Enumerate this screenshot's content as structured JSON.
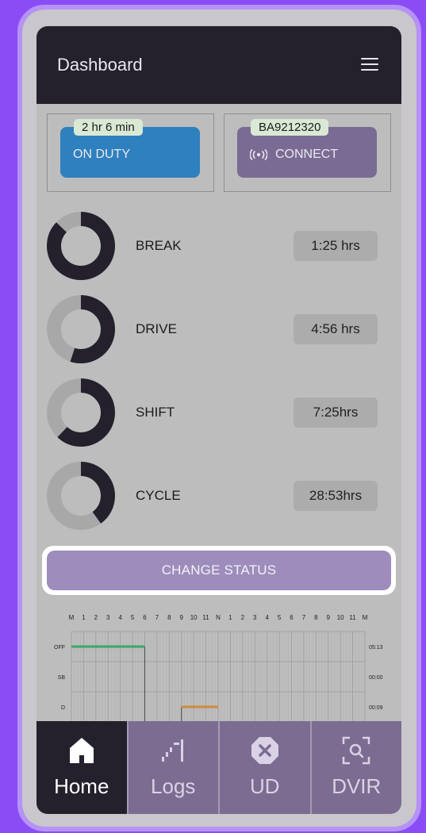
{
  "header": {
    "title": "Dashboard",
    "menu_icon": "hamburger-menu-icon"
  },
  "status": {
    "duty": {
      "timer": "2 hr 6 min",
      "label": "ON DUTY",
      "color": "#2f80be"
    },
    "device": {
      "id": "BA9212320",
      "label": "CONNECT",
      "icon": "wireless-signal-icon",
      "color": "#7a6b94"
    }
  },
  "timers": [
    {
      "label": "BREAK",
      "value": "1:25 hrs",
      "progress": 0.87
    },
    {
      "label": "DRIVE",
      "value": "4:56 hrs",
      "progress": 0.55
    },
    {
      "label": "SHIFT",
      "value": "7:25hrs",
      "progress": 0.62
    },
    {
      "label": "CYCLE",
      "value": "28:53hrs",
      "progress": 0.4
    }
  ],
  "change_status": {
    "label": "CHANGE STATUS"
  },
  "chart_data": {
    "type": "line",
    "x_ticks": [
      "M",
      "1",
      "2",
      "3",
      "4",
      "5",
      "6",
      "7",
      "8",
      "9",
      "10",
      "11",
      "N",
      "1",
      "2",
      "3",
      "4",
      "5",
      "6",
      "7",
      "8",
      "9",
      "10",
      "11",
      "M"
    ],
    "rows": [
      "OFF",
      "SB",
      "D"
    ],
    "totals": [
      "05:13",
      "00:00",
      "00:09"
    ],
    "segments": [
      {
        "row": "OFF",
        "start_hour": 0,
        "end_hour": 6,
        "color": "#3aa866"
      },
      {
        "row": "D",
        "start_hour": 9,
        "end_hour": 12,
        "color": "#d08a3a"
      }
    ],
    "transitions": [
      {
        "hour": 6,
        "from": "OFF",
        "to": "below"
      },
      {
        "hour": 9,
        "from": "below",
        "to": "D"
      }
    ]
  },
  "nav": [
    {
      "label": "Home",
      "icon": "home-icon",
      "active": true
    },
    {
      "label": "Logs",
      "icon": "logs-icon",
      "active": false
    },
    {
      "label": "UD",
      "icon": "close-circle-icon",
      "active": false
    },
    {
      "label": "DVIR",
      "icon": "scan-search-icon",
      "active": false
    }
  ]
}
